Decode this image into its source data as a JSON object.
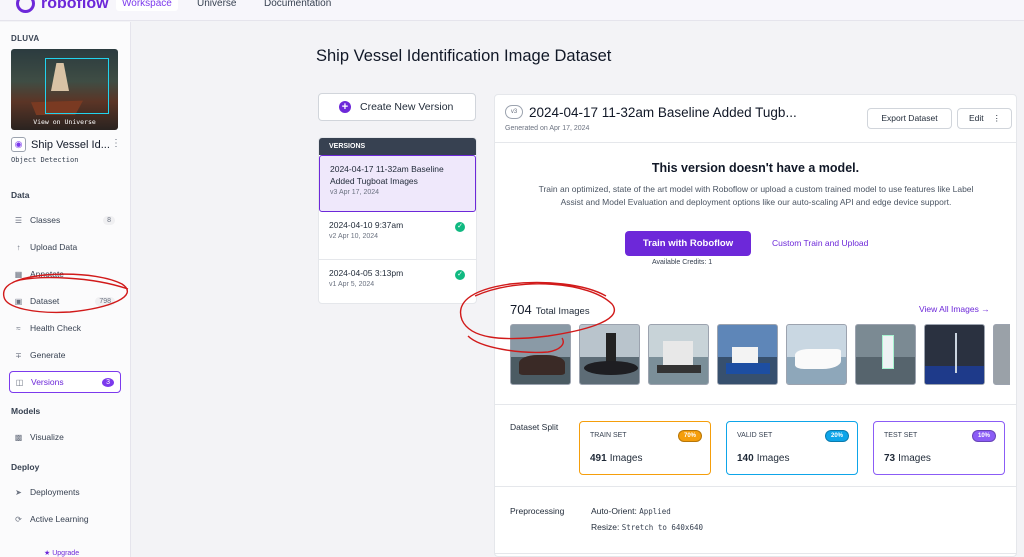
{
  "nav": {
    "logo": "roboflow",
    "links": [
      "Workspace",
      "Universe",
      "Documentation"
    ]
  },
  "sidebar": {
    "workspace": "DLUVA",
    "thumb_caption": "View on Universe",
    "project_name": "Ship Vessel Id...",
    "project_type": "Object Detection",
    "sections": {
      "data": "Data",
      "models": "Models",
      "deploy": "Deploy"
    },
    "items": {
      "classes": {
        "label": "Classes",
        "count": "8"
      },
      "upload": {
        "label": "Upload Data"
      },
      "annotate": {
        "label": "Annotate"
      },
      "dataset": {
        "label": "Dataset",
        "count": "798"
      },
      "health": {
        "label": "Health Check"
      },
      "generate": {
        "label": "Generate"
      },
      "versions": {
        "label": "Versions",
        "count": "3"
      },
      "visualize": {
        "label": "Visualize"
      },
      "deployments": {
        "label": "Deployments"
      },
      "active": {
        "label": "Active Learning"
      }
    },
    "upgrade": "Upgrade"
  },
  "main": {
    "title": "Ship Vessel Identification Image Dataset",
    "create_version": "Create New Version",
    "versions_header": "VERSIONS",
    "versions": [
      {
        "title": "2024-04-17 11-32am Baseline Added Tugboat Images",
        "sub": "v3 Apr 17, 2024"
      },
      {
        "title": "2024-04-10 9:37am",
        "sub": "v2 Apr 10, 2024"
      },
      {
        "title": "2024-04-05 3:13pm",
        "sub": "v1 Apr 5, 2024"
      }
    ]
  },
  "panel": {
    "badge": "v3",
    "version_name": "2024-04-17 11-32am Baseline Added Tugb...",
    "generated": "Generated on Apr 17, 2024",
    "export": "Export Dataset",
    "edit": "Edit",
    "no_model_title": "This version doesn't have a model.",
    "no_model_desc": "Train an optimized, state of the art model with Roboflow or upload a custom trained model to use features like Label Assist and Model Evaluation and deployment options like our auto-scaling API and edge device support.",
    "train_btn": "Train with Roboflow",
    "custom_link": "Custom Train and Upload",
    "credits": "Available Credits:  1",
    "total_count": "704",
    "total_label": "Total Images",
    "view_all": "View All Images",
    "split_label": "Dataset Split",
    "splits": [
      {
        "name": "TRAIN SET",
        "pct": "70%",
        "count": "491",
        "unit": "Images",
        "color": "#f59e0b"
      },
      {
        "name": "VALID SET",
        "pct": "20%",
        "count": "140",
        "unit": "Images",
        "color": "#0ea5e9"
      },
      {
        "name": "TEST SET",
        "pct": "10%",
        "count": "73",
        "unit": "Images",
        "color": "#8b5cf6"
      }
    ],
    "prep_label": "Preprocessing",
    "prep": [
      {
        "key": "Auto-Orient:",
        "value": "Applied"
      },
      {
        "key": "Resize:",
        "value": "Stretch to 640x640"
      }
    ]
  },
  "colors": {
    "accent": "#6d28d9",
    "success": "#10b981",
    "annotation": "#d11a1a"
  }
}
